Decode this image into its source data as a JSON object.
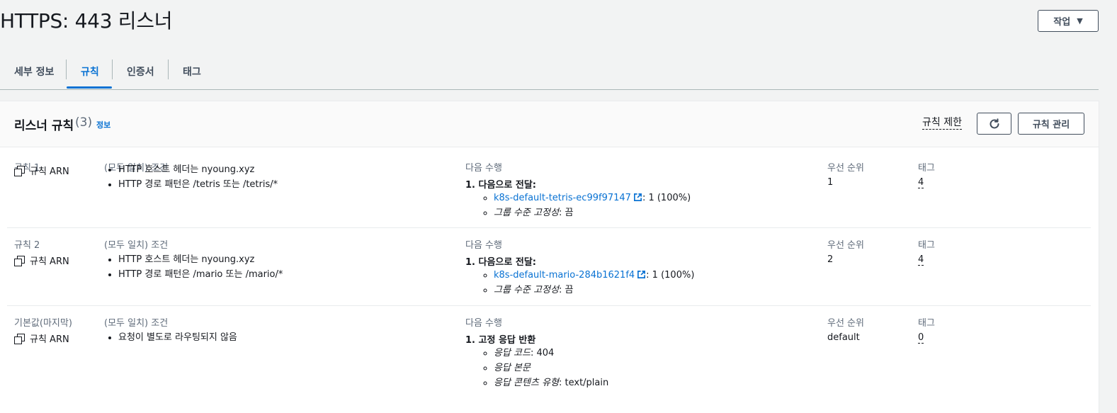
{
  "page": {
    "title": "HTTPS: 443 리스너",
    "actions_label": "작업"
  },
  "tabs": [
    {
      "label": "세부 정보"
    },
    {
      "label": "규칙"
    },
    {
      "label": "인증서"
    },
    {
      "label": "태그"
    }
  ],
  "panel": {
    "title": "리스너 규칙",
    "count": "(3)",
    "info_label": "정보",
    "limit_label": "규칙 제한",
    "manage_label": "규칙 관리"
  },
  "rules": [
    {
      "name": "규칙 1",
      "arn_label": "규칙 ARN",
      "conditions_label": "(모두 일치) 조건",
      "conditions": [
        "HTTP 호스트 헤더는 nyoung.xyz",
        "HTTP 경로 패턴은 /tetris 또는 /tetris/*"
      ],
      "action_label": "다음 수행",
      "action_head": "1. 다음으로 전달:",
      "target_group": "k8s-default-tetris-ec99f97147",
      "target_weight": ": 1 (100%)",
      "stickiness_label": "그룹 수준 고정성",
      "stickiness_value": ": 끔",
      "priority_label": "우선 순위",
      "priority": "1",
      "tags_label": "태그",
      "tags": "4"
    },
    {
      "name": "규칙 2",
      "arn_label": "규칙 ARN",
      "conditions_label": "(모두 일치) 조건",
      "conditions": [
        "HTTP 호스트 헤더는 nyoung.xyz",
        "HTTP 경로 패턴은 /mario 또는 /mario/*"
      ],
      "action_label": "다음 수행",
      "action_head": "1. 다음으로 전달:",
      "target_group": "k8s-default-mario-284b1621f4",
      "target_weight": ": 1 (100%)",
      "stickiness_label": "그룹 수준 고정성",
      "stickiness_value": ": 끔",
      "priority_label": "우선 순위",
      "priority": "2",
      "tags_label": "태그",
      "tags": "4"
    },
    {
      "name": "기본값(마지막)",
      "arn_label": "규칙 ARN",
      "conditions_label": "(모두 일치) 조건",
      "conditions": [
        "요청이 별도로 라우팅되지 않음"
      ],
      "action_label": "다음 수행",
      "action_head": "1. 고정 응답 반환",
      "response_code_label": "응답 코드",
      "response_code": ": 404",
      "response_body_label": "응답 본문",
      "content_type_label": "응답 콘텐츠 유형",
      "content_type": ": text/plain",
      "priority_label": "우선 순위",
      "priority": "default",
      "tags_label": "태그",
      "tags": "0"
    }
  ]
}
